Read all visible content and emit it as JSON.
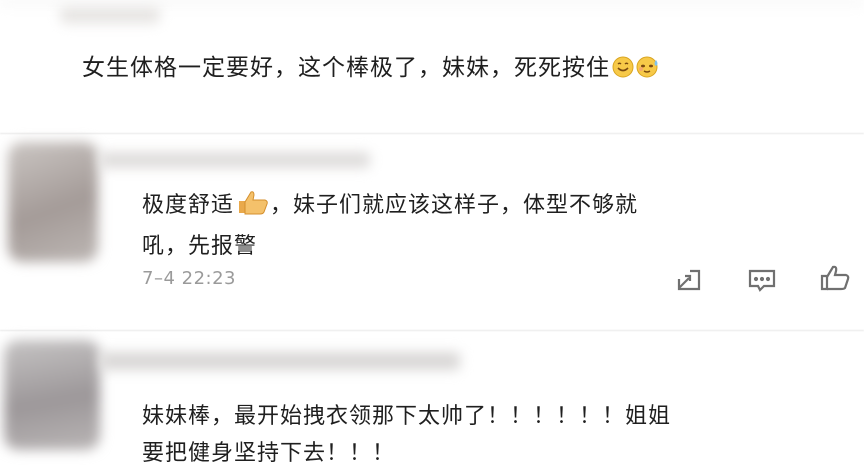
{
  "comments": [
    {
      "text": "女生体格一定要好，这个棒极了，妹妹，死死按住",
      "emojis": [
        "smile-emoji",
        "sweat-smile-emoji"
      ]
    },
    {
      "line1": "极度舒适",
      "line1_after": "，妹子们就应该这样子，体型不够就",
      "line2": "吼，先报警",
      "emoji": "thumbs-up-emoji",
      "time": "7–4 22:23",
      "actions": [
        "share-icon",
        "comment-icon",
        "like-icon"
      ]
    },
    {
      "line1": "妹妹棒，最开始拽衣领那下太帅了！！！！！！姐姐",
      "line2": "要把健身坚持下去！！！"
    }
  ],
  "colors": {
    "text": "#1f1f1f",
    "timestamp": "#9a9a9a",
    "icon": "#707070",
    "divider": "#e6e6e6",
    "blur": "#d4d2d0"
  }
}
